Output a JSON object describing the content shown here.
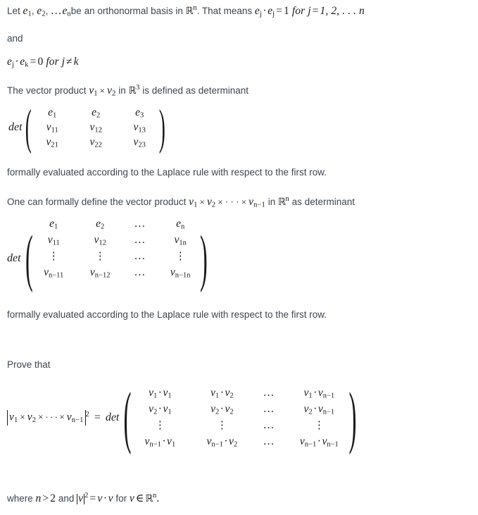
{
  "document": {
    "type": "math-problem-statement",
    "background": "#ffffff",
    "body_text_color": "#3c4650",
    "math_text_color": "#1a1a1a"
  },
  "lines": {
    "l1": {
      "pre": "Let ",
      "e1": "e",
      "e1sub": "1",
      "comma1": ",",
      "e2": "e",
      "e2sub": "2",
      "comma2": ",",
      "dots": "...",
      "en": "e",
      "ensub": "n",
      "mid": "be an orthonormal basis in ",
      "rn_sup": "n",
      "mid2": ". That means ",
      "ej": "e",
      "ejsub": "j",
      "dot": "·",
      "ej2": "e",
      "ej2sub": "j",
      "eq": "=",
      "one": "1",
      "for": "for",
      "j": "j",
      "eq2": "=",
      "tail": "1, 2, . . . n"
    },
    "l2": "and",
    "l3": {
      "ej": "e",
      "ejsub": "j",
      "dot": "·",
      "ek": "e",
      "eksub": "k",
      "eq": "=",
      "zero": "0",
      "for": "for",
      "j": "j",
      "neq": "≠",
      "k": "k"
    },
    "l4": {
      "pre": "The vector product ",
      "v1": "v",
      "v1sub": "1",
      "times": "×",
      "v2": "v",
      "v2sub": "2",
      "mid": " in ",
      "rn_sup": "3",
      "post": " is defined as determinant"
    },
    "l5": "formally evaluated according to the Laplace rule with respect to the first row.",
    "l6": {
      "pre": "One can formally define the vector product ",
      "v1": "v",
      "v1sub": "1",
      "times": "×",
      "v2": "v",
      "v2sub": "2",
      "times2": "×",
      "cdots": "· · ·",
      "times3": "×",
      "vn": "v",
      "vnsub": "n−1",
      "mid": " in ",
      "rn_sup": "n",
      "post": " as determinant"
    },
    "l7": "formally evaluated according to the Laplace rule with respect to the first row.",
    "l8": "Prove that",
    "l9": {
      "pre": "where ",
      "n": "n",
      "gt": ">",
      "two": "2",
      "and": " and ",
      "v": "v",
      "sq": "2",
      "eq": "=",
      "v2": "v",
      "dot": "·",
      "v3": "v",
      "for": "for",
      "v4": "v",
      "in": "∈",
      "rn_sup": "n",
      "period": "."
    }
  },
  "det3": {
    "label": "det",
    "rows": [
      [
        "e₁",
        "e₂",
        "e₃"
      ],
      [
        "v₁₁",
        "v₁₂",
        "v₁₃"
      ],
      [
        "v₂₁",
        "v₂₂",
        "v₂₃"
      ]
    ],
    "cells": [
      [
        {
          "base": "e",
          "sub": "1"
        },
        {
          "base": "e",
          "sub": "2"
        },
        {
          "base": "e",
          "sub": "3"
        }
      ],
      [
        {
          "base": "v",
          "sub": "11"
        },
        {
          "base": "v",
          "sub": "12"
        },
        {
          "base": "v",
          "sub": "13"
        }
      ],
      [
        {
          "base": "v",
          "sub": "21"
        },
        {
          "base": "v",
          "sub": "22"
        },
        {
          "base": "v",
          "sub": "23"
        }
      ]
    ]
  },
  "detn": {
    "label": "det",
    "cells": [
      [
        {
          "base": "e",
          "sub": "1"
        },
        {
          "base": "e",
          "sub": "2"
        },
        {
          "dots": "..."
        },
        {
          "base": "e",
          "sub": "n"
        }
      ],
      [
        {
          "base": "v",
          "sub": "11"
        },
        {
          "base": "v",
          "sub": "12"
        },
        {
          "dots": "..."
        },
        {
          "base": "v",
          "sub": "1n"
        }
      ],
      [
        {
          "vdots": true
        },
        {
          "vdots": true
        },
        {
          "dots": "..."
        },
        {
          "vdots": true
        }
      ],
      [
        {
          "base": "v",
          "sub": "n−11"
        },
        {
          "base": "v",
          "sub": "n−12"
        },
        {
          "dots": "..."
        },
        {
          "base": "v",
          "sub": "n−1n"
        }
      ]
    ]
  },
  "equation": {
    "lhs": {
      "v1": "v",
      "v1sub": "1",
      "times": "×",
      "v2": "v",
      "v2sub": "2",
      "times2": "×",
      "cdots": "· · ·",
      "times3": "×",
      "vn": "v",
      "vnsub": "n−1",
      "exp": "2"
    },
    "eq": "=",
    "label": "det",
    "gram": [
      [
        {
          "a": "v",
          "asub": "1",
          "b": "v",
          "bsub": "1"
        },
        {
          "a": "v",
          "asub": "1",
          "b": "v",
          "bsub": "2"
        },
        {
          "dots": "..."
        },
        {
          "a": "v",
          "asub": "1",
          "b": "v",
          "bsub": "n−1"
        }
      ],
      [
        {
          "a": "v",
          "asub": "2",
          "b": "v",
          "bsub": "1"
        },
        {
          "a": "v",
          "asub": "2",
          "b": "v",
          "bsub": "2"
        },
        {
          "dots": "..."
        },
        {
          "a": "v",
          "asub": "2",
          "b": "v",
          "bsub": "n−1"
        }
      ],
      [
        {
          "vdots": true
        },
        {
          "vdots": true
        },
        {
          "dots": "..."
        },
        {
          "vdots": true
        }
      ],
      [
        {
          "a": "v",
          "asub": "n−1",
          "b": "v",
          "bsub": "1"
        },
        {
          "a": "v",
          "asub": "n−1",
          "b": "v",
          "bsub": "2"
        },
        {
          "dots": "..."
        },
        {
          "a": "v",
          "asub": "n−1",
          "b": "v",
          "bsub": "n−1"
        }
      ]
    ]
  }
}
